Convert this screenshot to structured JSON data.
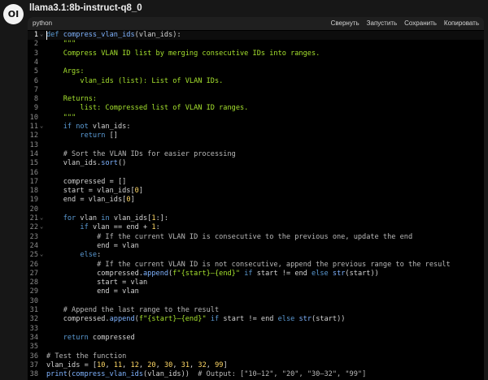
{
  "header": {
    "avatar_initials": "OI",
    "model_name": "llama3.1:8b-instruct-q8_0"
  },
  "code_block": {
    "language": "python",
    "actions": [
      "Свернуть",
      "Запустить",
      "Сохранить",
      "Копировать"
    ],
    "active_line": 1
  },
  "colors": {
    "keyword": "#5b9bd5",
    "function": "#7fb3ff",
    "string": "#a6e22e",
    "comment": "#b8b8b8",
    "number": "#ffd866",
    "plain": "#d4d4d4"
  },
  "icons": {
    "fold": "chevron-down-icon"
  },
  "lines": [
    {
      "n": "1",
      "fold": true,
      "tokens": [
        [
          "kw",
          "def "
        ],
        [
          "fn",
          "compress_vlan_ids"
        ],
        [
          "pl",
          "("
        ],
        [
          "pl",
          "vlan_ids"
        ],
        [
          "pl",
          "):"
        ]
      ]
    },
    {
      "n": "2",
      "tokens": [
        [
          "str",
          "    \"\"\""
        ]
      ]
    },
    {
      "n": "3",
      "tokens": [
        [
          "str",
          "    Compress VLAN ID list by merging consecutive IDs into ranges."
        ]
      ]
    },
    {
      "n": "4",
      "tokens": []
    },
    {
      "n": "5",
      "tokens": [
        [
          "str",
          "    Args:"
        ]
      ]
    },
    {
      "n": "6",
      "tokens": [
        [
          "str",
          "        vlan_ids (list): List of VLAN IDs."
        ]
      ]
    },
    {
      "n": "7",
      "tokens": []
    },
    {
      "n": "8",
      "tokens": [
        [
          "str",
          "    Returns:"
        ]
      ]
    },
    {
      "n": "9",
      "tokens": [
        [
          "str",
          "        list: Compressed list of VLAN ID ranges."
        ]
      ]
    },
    {
      "n": "10",
      "tokens": [
        [
          "str",
          "    \"\"\""
        ]
      ]
    },
    {
      "n": "11",
      "fold": true,
      "tokens": [
        [
          "pl",
          "    "
        ],
        [
          "kw",
          "if not "
        ],
        [
          "pl",
          "vlan_ids:"
        ]
      ]
    },
    {
      "n": "12",
      "tokens": [
        [
          "pl",
          "        "
        ],
        [
          "kw",
          "return "
        ],
        [
          "pl",
          "[]"
        ]
      ]
    },
    {
      "n": "13",
      "tokens": []
    },
    {
      "n": "14",
      "tokens": [
        [
          "cm",
          "    # Sort the VLAN IDs for easier processing"
        ]
      ]
    },
    {
      "n": "15",
      "tokens": [
        [
          "pl",
          "    vlan_ids."
        ],
        [
          "fn",
          "sort"
        ],
        [
          "pl",
          "()"
        ]
      ]
    },
    {
      "n": "16",
      "tokens": []
    },
    {
      "n": "17",
      "tokens": [
        [
          "pl",
          "    compressed = []"
        ]
      ]
    },
    {
      "n": "18",
      "tokens": [
        [
          "pl",
          "    start = vlan_ids["
        ],
        [
          "num",
          "0"
        ],
        [
          "pl",
          "]"
        ]
      ]
    },
    {
      "n": "19",
      "tokens": [
        [
          "pl",
          "    end = vlan_ids["
        ],
        [
          "num",
          "0"
        ],
        [
          "pl",
          "]"
        ]
      ]
    },
    {
      "n": "20",
      "tokens": []
    },
    {
      "n": "21",
      "fold": true,
      "tokens": [
        [
          "pl",
          "    "
        ],
        [
          "kw",
          "for "
        ],
        [
          "pl",
          "vlan "
        ],
        [
          "kw",
          "in "
        ],
        [
          "pl",
          "vlan_ids["
        ],
        [
          "num",
          "1"
        ],
        [
          "pl",
          ":]:"
        ]
      ]
    },
    {
      "n": "22",
      "fold": true,
      "tokens": [
        [
          "pl",
          "        "
        ],
        [
          "kw",
          "if "
        ],
        [
          "pl",
          "vlan == end + "
        ],
        [
          "num",
          "1"
        ],
        [
          "pl",
          ":"
        ]
      ]
    },
    {
      "n": "23",
      "tokens": [
        [
          "cm",
          "            # If the current VLAN ID is consecutive to the previous one, update the end"
        ]
      ]
    },
    {
      "n": "24",
      "tokens": [
        [
          "pl",
          "            end = vlan"
        ]
      ]
    },
    {
      "n": "25",
      "fold": true,
      "tokens": [
        [
          "pl",
          "        "
        ],
        [
          "kw",
          "else"
        ],
        [
          "pl",
          ":"
        ]
      ]
    },
    {
      "n": "26",
      "tokens": [
        [
          "cm",
          "            # If the current VLAN ID is not consecutive, append the previous range to the result"
        ]
      ]
    },
    {
      "n": "27",
      "tokens": [
        [
          "pl",
          "            compressed."
        ],
        [
          "fn",
          "append"
        ],
        [
          "pl",
          "("
        ],
        [
          "str",
          "f\"{start}—{end}\""
        ],
        [
          "pl",
          " "
        ],
        [
          "kw",
          "if "
        ],
        [
          "pl",
          "start != end "
        ],
        [
          "kw",
          "else "
        ],
        [
          "fn",
          "str"
        ],
        [
          "pl",
          "(start))"
        ]
      ]
    },
    {
      "n": "28",
      "tokens": [
        [
          "pl",
          "            start = vlan"
        ]
      ]
    },
    {
      "n": "29",
      "tokens": [
        [
          "pl",
          "            end = vlan"
        ]
      ]
    },
    {
      "n": "30",
      "tokens": []
    },
    {
      "n": "31",
      "tokens": [
        [
          "cm",
          "    # Append the last range to the result"
        ]
      ]
    },
    {
      "n": "32",
      "tokens": [
        [
          "pl",
          "    compressed."
        ],
        [
          "fn",
          "append"
        ],
        [
          "pl",
          "("
        ],
        [
          "str",
          "f\"{start}—{end}\""
        ],
        [
          "pl",
          " "
        ],
        [
          "kw",
          "if "
        ],
        [
          "pl",
          "start != end "
        ],
        [
          "kw",
          "else "
        ],
        [
          "fn",
          "str"
        ],
        [
          "pl",
          "(start))"
        ]
      ]
    },
    {
      "n": "33",
      "tokens": []
    },
    {
      "n": "34",
      "tokens": [
        [
          "pl",
          "    "
        ],
        [
          "kw",
          "return "
        ],
        [
          "pl",
          "compressed"
        ]
      ]
    },
    {
      "n": "35",
      "tokens": []
    },
    {
      "n": "36",
      "tokens": [
        [
          "cm",
          "# Test the function"
        ]
      ]
    },
    {
      "n": "37",
      "tokens": [
        [
          "pl",
          "vlan_ids = ["
        ],
        [
          "num",
          "10"
        ],
        [
          "pl",
          ", "
        ],
        [
          "num",
          "11"
        ],
        [
          "pl",
          ", "
        ],
        [
          "num",
          "12"
        ],
        [
          "pl",
          ", "
        ],
        [
          "num",
          "20"
        ],
        [
          "pl",
          ", "
        ],
        [
          "num",
          "30"
        ],
        [
          "pl",
          ", "
        ],
        [
          "num",
          "31"
        ],
        [
          "pl",
          ", "
        ],
        [
          "num",
          "32"
        ],
        [
          "pl",
          ", "
        ],
        [
          "num",
          "99"
        ],
        [
          "pl",
          "]"
        ]
      ]
    },
    {
      "n": "38",
      "tokens": [
        [
          "fn",
          "print"
        ],
        [
          "pl",
          "("
        ],
        [
          "fn",
          "compress_vlan_ids"
        ],
        [
          "pl",
          "(vlan_ids))  "
        ],
        [
          "cm",
          "# Output: [\"10—12\", \"20\", \"30—32\", \"99\"]"
        ]
      ]
    }
  ]
}
